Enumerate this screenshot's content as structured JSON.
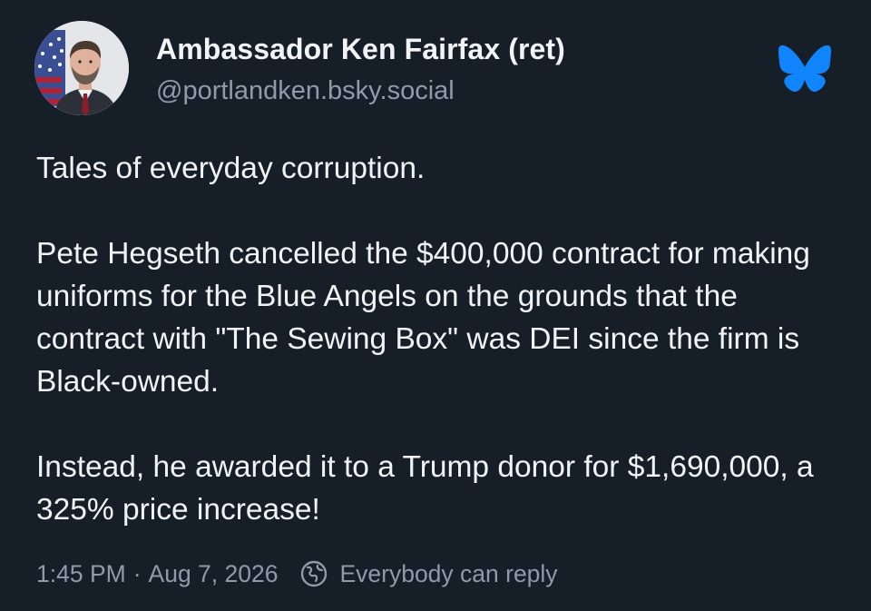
{
  "author": {
    "display_name": "Ambassador Ken Fairfax (ret)",
    "handle": "@portlandken.bsky.social",
    "avatar_icon": "profile-photo"
  },
  "brand": {
    "logo_icon": "bluesky-butterfly-icon",
    "accent_color": "#1185fe"
  },
  "post": {
    "paragraphs": [
      "Tales of everyday corruption.",
      "Pete Hegseth cancelled the $400,000 contract for making uniforms for the Blue Angels on the grounds that the contract with \"The Sewing Box\" was DEI since the firm is Black-owned.",
      "Instead, he awarded it to a Trump donor for $1,690,000, a 325% price increase!"
    ]
  },
  "meta": {
    "time": "1:45 PM",
    "separator": "·",
    "date": "Aug 7, 2026",
    "reply_setting_icon": "globe-icon",
    "reply_setting": "Everybody can reply"
  },
  "colors": {
    "background": "#161e27",
    "text": "#f1f3f5",
    "muted": "#8f9bab"
  }
}
